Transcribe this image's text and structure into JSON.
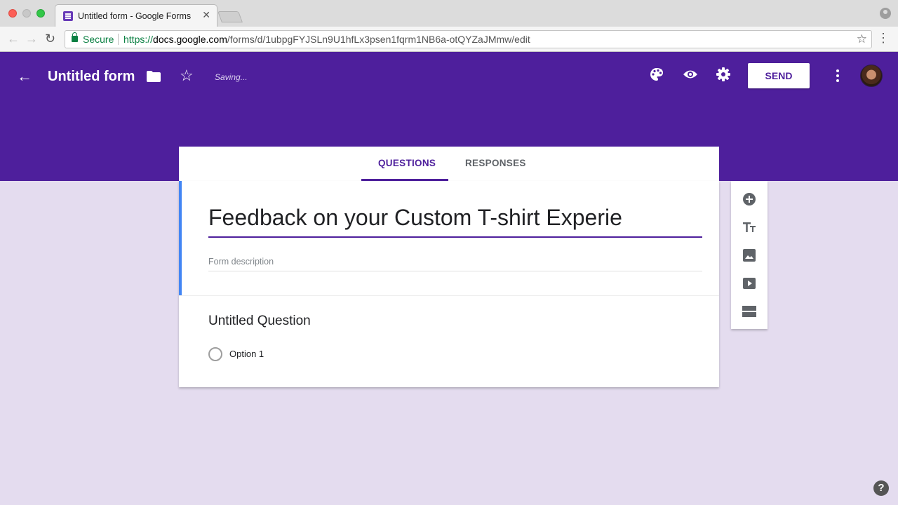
{
  "browser": {
    "tab_title": "Untitled form - Google Forms",
    "tab_close": "✕",
    "secure_label": "Secure",
    "url_scheme": "https://",
    "url_host": "docs.google.com",
    "url_path": "/forms/d/1ubpgFYJSLn9U1hfLx3psen1fqrm1NB6a-otQYZaJMmw/edit"
  },
  "header": {
    "form_name": "Untitled form",
    "status": "Saving...",
    "send_label": "SEND",
    "background_color": "#4e1f9c"
  },
  "tabs": [
    {
      "label": "QUESTIONS",
      "active": true
    },
    {
      "label": "RESPONSES",
      "active": false
    }
  ],
  "form": {
    "title": "Feedback on your Custom T-shirt Experie",
    "description_placeholder": "Form description",
    "question": {
      "title": "Untitled Question",
      "options": [
        "Option 1"
      ]
    }
  },
  "side_toolbar": [
    "add-question-icon",
    "add-title-icon",
    "add-image-icon",
    "add-video-icon",
    "add-section-icon"
  ],
  "help_label": "?"
}
